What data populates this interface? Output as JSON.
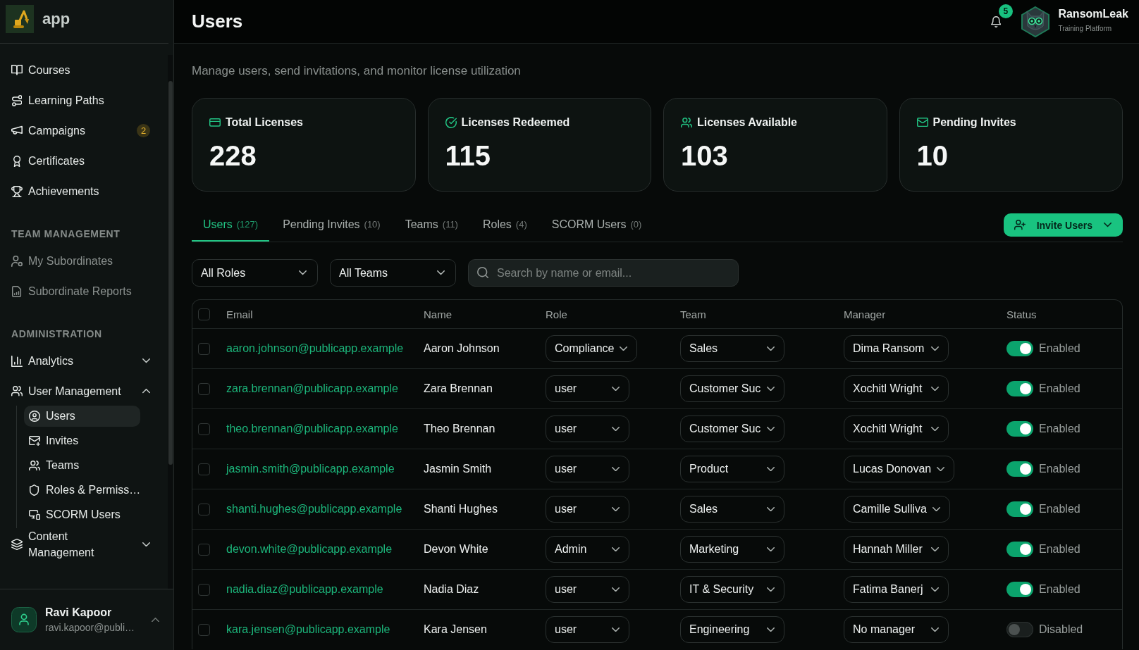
{
  "sidebar": {
    "brand": {
      "name": "app"
    },
    "nav": [
      {
        "label": "Courses",
        "selected": false
      },
      {
        "label": "Learning Paths",
        "selected": false
      },
      {
        "label": "Campaigns",
        "selected": false,
        "badge": "2"
      },
      {
        "label": "Certificates",
        "selected": false
      },
      {
        "label": "Achievements",
        "selected": false
      }
    ],
    "sections": [
      {
        "title": "TEAM MANAGEMENT",
        "items": [
          {
            "label": "My Subordinates",
            "selected": false,
            "disabled": true
          },
          {
            "label": "Subordinate Reports",
            "selected": false,
            "disabled": true
          }
        ]
      },
      {
        "title": "ADMINISTRATION",
        "items": [
          {
            "label": "Analytics",
            "selected": false,
            "expanded": false
          },
          {
            "label": "User Management",
            "selected": false,
            "expanded": true,
            "children": [
              {
                "label": "Users",
                "selected": true
              },
              {
                "label": "Invites",
                "selected": false
              },
              {
                "label": "Teams",
                "selected": false
              },
              {
                "label": "Roles & Permiss…",
                "selected": false
              },
              {
                "label": "SCORM Users",
                "selected": false
              }
            ]
          },
          {
            "label": "Content Management",
            "selected": false,
            "expanded": false
          }
        ]
      }
    ],
    "user": {
      "name": "Ravi Kapoor",
      "email": "ravi.kapoor@publi…"
    }
  },
  "header": {
    "title": "Users",
    "notifications": {
      "count": "5"
    },
    "account": {
      "name": "RansomLeak",
      "tagline": "Training Platform"
    }
  },
  "subtitle": "Manage users, send invitations, and monitor license utilization",
  "stats": [
    {
      "label": "Total Licenses",
      "value": "228"
    },
    {
      "label": "Licenses Redeemed",
      "value": "115"
    },
    {
      "label": "Licenses Available",
      "value": "103"
    },
    {
      "label": "Pending Invites",
      "value": "10"
    }
  ],
  "tabs": [
    {
      "label": "Users",
      "count": "(127)",
      "selected": true
    },
    {
      "label": "Pending Invites",
      "count": "(10)",
      "selected": false
    },
    {
      "label": "Teams",
      "count": "(11)",
      "selected": false
    },
    {
      "label": "Roles",
      "count": "(4)",
      "selected": false
    },
    {
      "label": "SCORM Users",
      "count": "(0)",
      "selected": false
    }
  ],
  "invite_button": {
    "label": "Invite Users"
  },
  "filters": {
    "role": {
      "value": "All Roles"
    },
    "team": {
      "value": "All Teams"
    },
    "search": {
      "placeholder": "Search by name or email..."
    }
  },
  "table": {
    "select_all": {
      "checked": false
    },
    "columns": [
      "Email",
      "Name",
      "Role",
      "Team",
      "Manager",
      "Status"
    ],
    "rows": [
      {
        "checked": false,
        "email": "aaron.johnson@publicapp.example",
        "name": "Aaron Johnson",
        "role": "Compliance",
        "team": "Sales",
        "manager": "Dima Ransom",
        "enabled": true,
        "status": "Enabled"
      },
      {
        "checked": false,
        "email": "zara.brennan@publicapp.example",
        "name": "Zara Brennan",
        "role": "user",
        "team": "Customer Suc",
        "manager": "Xochitl Wright",
        "enabled": true,
        "status": "Enabled"
      },
      {
        "checked": false,
        "email": "theo.brennan@publicapp.example",
        "name": "Theo Brennan",
        "role": "user",
        "team": "Customer Suc",
        "manager": "Xochitl Wright",
        "enabled": true,
        "status": "Enabled"
      },
      {
        "checked": false,
        "email": "jasmin.smith@publicapp.example",
        "name": "Jasmin Smith",
        "role": "user",
        "team": "Product",
        "manager": "Lucas Donovan",
        "enabled": true,
        "status": "Enabled"
      },
      {
        "checked": false,
        "email": "shanti.hughes@publicapp.example",
        "name": "Shanti Hughes",
        "role": "user",
        "team": "Sales",
        "manager": "Camille Sulliva",
        "enabled": true,
        "status": "Enabled"
      },
      {
        "checked": false,
        "email": "devon.white@publicapp.example",
        "name": "Devon White",
        "role": "Admin",
        "team": "Marketing",
        "manager": "Hannah Miller",
        "enabled": true,
        "status": "Enabled"
      },
      {
        "checked": false,
        "email": "nadia.diaz@publicapp.example",
        "name": "Nadia Diaz",
        "role": "user",
        "team": "IT & Security",
        "manager": "Fatima Banerj",
        "enabled": true,
        "status": "Enabled"
      },
      {
        "checked": false,
        "email": "kara.jensen@publicapp.example",
        "name": "Kara Jensen",
        "role": "user",
        "team": "Engineering",
        "manager": "No manager",
        "enabled": false,
        "status": "Disabled"
      }
    ]
  }
}
